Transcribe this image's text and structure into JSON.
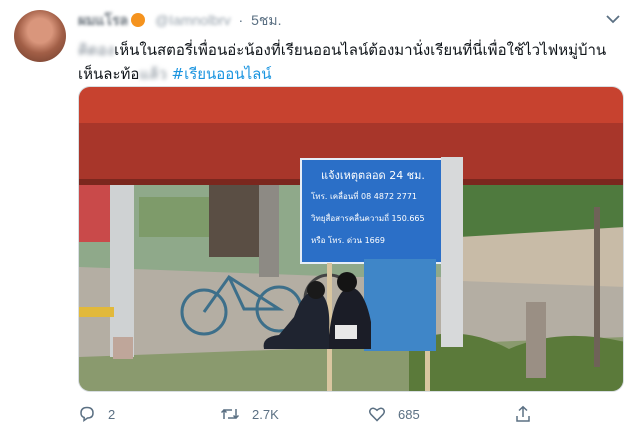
{
  "tweet": {
    "display_name": "ผมแโรล",
    "handle": "@Iamnolbrv",
    "dot": "·",
    "time": "5ชม.",
    "text_hidden_start": "คิดอง",
    "text_main": "เห็นในสตอรี่เพื่อนอ่ะน้องที่เรียนออนไลน์ต้องมานั่งเรียนที่นี่เพื่อใช้ไวไฟหมู่บ้าน",
    "text_line2_start": "เห็นละท้อ",
    "text_hidden_end": "แล้ว",
    "hashtag": "#เรียนออนไลน์"
  },
  "sign": {
    "title": "แจ้งเหตุตลอด 24 ชม.",
    "line1": "โทร.  เคลื่อนที่       08 4872 2771",
    "line2": "วิทยุสื่อสารคลื่นความถี่   150.665",
    "line3": "หรือ  โทร.  ด่วน     1669"
  },
  "actions": {
    "reply_count": "2",
    "retweet_count": "2.7K",
    "like_count": "685"
  },
  "icons": {
    "reply": "reply-icon",
    "retweet": "retweet-icon",
    "like": "heart-icon",
    "share": "share-icon",
    "caret": "chevron-down-icon"
  },
  "colors": {
    "hashtag": "#1b95e0",
    "secondary_text": "#5b7083",
    "sign_blue": "#2b6fc7",
    "roof_red": "#b83a2c"
  }
}
